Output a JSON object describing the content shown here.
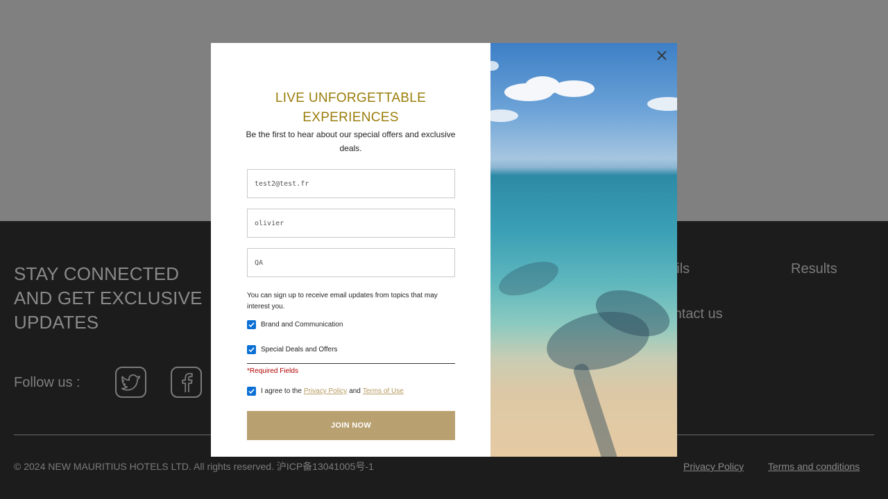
{
  "footer": {
    "heading": "STAY CONNECTED AND GET EXCLUSIVE UPDATES",
    "nav_links": [
      "Trails",
      "Results",
      "Contact us"
    ],
    "follow_label": "Follow us :",
    "social_icons": [
      "twitter-icon",
      "facebook-icon"
    ],
    "copyright": "© 2024 NEW MAURITIUS HOTELS LTD. All rights reserved. 沪ICP备13041005号-1",
    "privacy_policy": "Privacy Policy",
    "terms_conditions": "Terms and conditions"
  },
  "modal": {
    "title_line1": "LIVE UNFORGETTABLE",
    "title_line2": "EXPERIENCES",
    "subtitle": "Be the first to hear about our special offers and exclusive deals.",
    "email_value": "test2@test.fr",
    "first_name_value": "olivier",
    "last_name_value": "QA",
    "info_text": "You can sign up to receive email updates from topics that may interest you.",
    "topic_1": "Brand and Communication",
    "topic_2": "Special Deals and Offers",
    "required_mark": "*",
    "required_text": "Required Fields",
    "agree_prefix": "I agree to the",
    "agree_privacy": "Privacy Policy",
    "agree_and": "and",
    "agree_terms": "Terms of Use",
    "join_label": "JOIN NOW",
    "close_icon": "close-icon"
  },
  "colors": {
    "accent_gold": "#9a7d0a",
    "button_tan": "#b8a070",
    "link_tan": "#b6995f",
    "checkbox_blue": "#0b6fd6",
    "required_red": "#b00000",
    "footer_bg": "#1c1c1c"
  }
}
